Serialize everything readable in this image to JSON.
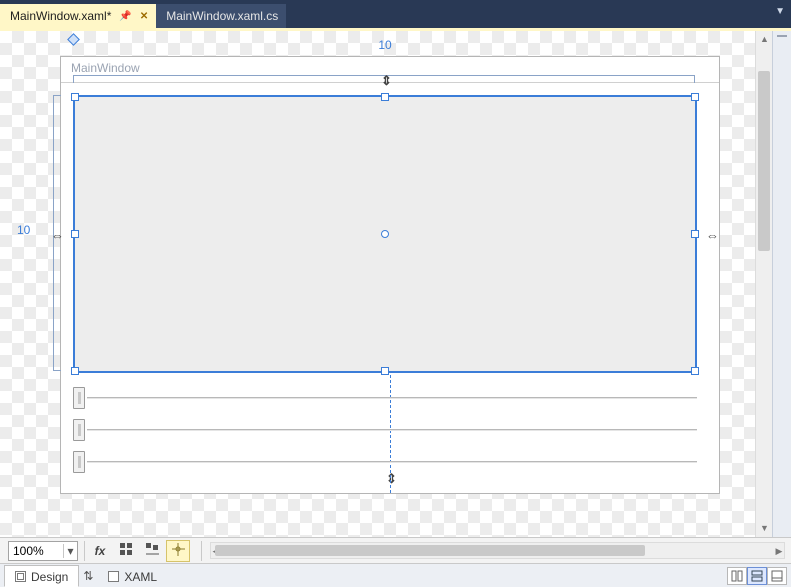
{
  "tabs": [
    {
      "label": "MainWindow.xaml*",
      "active": true,
      "pinned": true,
      "closable": true
    },
    {
      "label": "MainWindow.xaml.cs",
      "active": false
    }
  ],
  "designer": {
    "window_title": "MainWindow",
    "margin_top_label": "10",
    "margin_left_label": "10"
  },
  "toolbar": {
    "zoom_value": "100%"
  },
  "bottom_tabs": {
    "design_label": "Design",
    "xaml_label": "XAML"
  }
}
